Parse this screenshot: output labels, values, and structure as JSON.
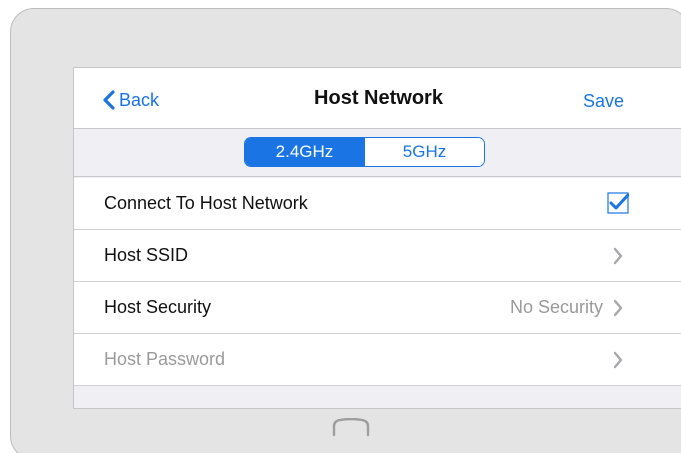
{
  "nav": {
    "back_label": "Back",
    "title": "Host Network",
    "save_label": "Save"
  },
  "bands": {
    "options": [
      "2.4GHz",
      "5GHz"
    ],
    "selected": "2.4GHz"
  },
  "rows": [
    {
      "label": "Connect To Host Network",
      "control": "checkbox",
      "checked": true
    },
    {
      "label": "Host SSID",
      "control": "chevron"
    },
    {
      "label": "Host Security",
      "value": "No Security",
      "control": "chevron"
    },
    {
      "label": "Host Password",
      "control": "chevron",
      "disabled": true
    }
  ],
  "colors": {
    "accent": "#1a74e4",
    "disabled_text": "#9a9a9a",
    "background": "#efeff4"
  },
  "icons": {
    "back": "chevron-left-icon",
    "check": "checkmark-icon",
    "disclosure": "chevron-right-icon",
    "home": "home-button-icon"
  }
}
